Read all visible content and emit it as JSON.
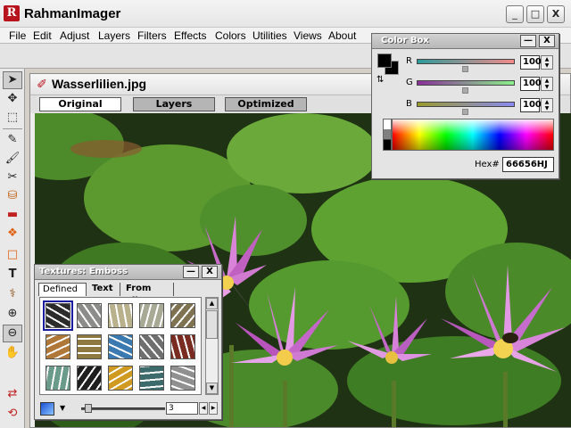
{
  "app": {
    "logo_letter": "R",
    "title": "RahmanImager",
    "minimize": "_",
    "maximize": "□",
    "close": "X"
  },
  "menu": [
    "File",
    "Edit",
    "Adjust",
    "Layers",
    "Filters",
    "Effects",
    "Colors",
    "Utilities",
    "Views",
    "About"
  ],
  "tools": [
    {
      "icon": "arrow-pointer-icon",
      "glyph": "➤"
    },
    {
      "icon": "move-arrow-icon",
      "glyph": "✥"
    },
    {
      "icon": "marquee-select-icon",
      "glyph": "⬚"
    },
    {
      "icon": "pencil-icon",
      "glyph": "✎"
    },
    {
      "icon": "brush-icon",
      "glyph": "🖌"
    },
    {
      "icon": "clone-stamp-icon",
      "glyph": "✂"
    },
    {
      "icon": "paint-bucket-icon",
      "glyph": "⛁"
    },
    {
      "icon": "eraser-icon",
      "glyph": "▬"
    },
    {
      "icon": "spray-icon",
      "glyph": "❖"
    },
    {
      "icon": "rectangle-shape-icon",
      "glyph": "□"
    },
    {
      "icon": "text-tool-icon",
      "glyph": "T"
    },
    {
      "icon": "eyedropper-icon",
      "glyph": "⚕"
    },
    {
      "icon": "zoom-in-icon",
      "glyph": "⊕"
    },
    {
      "icon": "zoom-out-icon",
      "glyph": "⊖"
    },
    {
      "icon": "hand-pan-icon",
      "glyph": "✋"
    },
    {
      "icon": "swap-colors-icon",
      "glyph": "⇄"
    },
    {
      "icon": "reset-colors-icon",
      "glyph": "⟲"
    }
  ],
  "document": {
    "title": "Wasserlilien.jpg",
    "tabs": [
      "Original",
      "Layers",
      "Optimized"
    ],
    "active_tab": "Original"
  },
  "colorbox": {
    "title": "Color Box",
    "channels": [
      {
        "label": "R",
        "value": "100",
        "color_from": "#2e9a9a",
        "color_to": "#f28a8a"
      },
      {
        "label": "G",
        "value": "100",
        "color_from": "#8a2e9a",
        "color_to": "#8af28a"
      },
      {
        "label": "B",
        "value": "100",
        "color_from": "#9a9a2e",
        "color_to": "#8a8af2"
      }
    ],
    "hex_label": "Hex#",
    "hex_value": "66656HJ",
    "foreground": "#000000",
    "background": "#000000"
  },
  "textures": {
    "title": "Textures: Emboss",
    "tabs": [
      "Defined",
      "Text",
      "From File"
    ],
    "slider_value": "3",
    "swatches": [
      "#2b2b2b",
      "#8c8c88",
      "#b9b08c",
      "#a8aa96",
      "#7e7250",
      "#b07838",
      "#8e7a40",
      "#3a7ab0",
      "#6f6f70",
      "#7a2c22",
      "#6a9a8a",
      "#1e1e1e",
      "#d09a20",
      "#3d6a6a",
      "#909090"
    ]
  }
}
